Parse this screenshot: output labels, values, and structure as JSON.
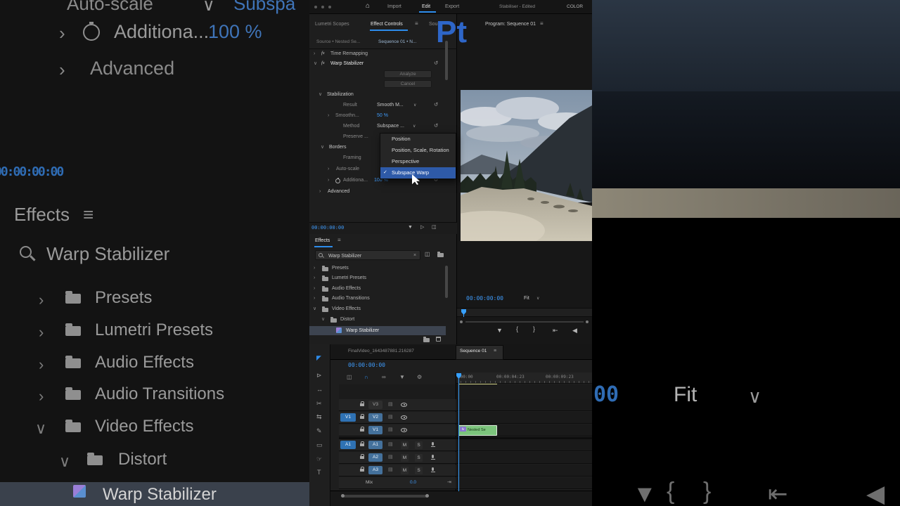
{
  "watermark": {
    "text": "Pt",
    "color": "#2e66c8"
  },
  "colors": {
    "accent": "#2d8ceb",
    "timecode": "#3f9bfa",
    "menu_highlight": "#2e5aa8",
    "clip_green": "#7cc47c",
    "target_badge": "#44719c"
  },
  "icons": {
    "hamburger": "≡",
    "home": "⌂",
    "chevron_right": "›",
    "chevron_down": "∨",
    "reset": "↺",
    "close": "×",
    "check": "✓",
    "fx": "fx",
    "funnel": "▼",
    "play_edit": "▷",
    "export": "◫",
    "mix_end": "⇥"
  },
  "app_bar": {
    "menu": [
      {
        "label": "Import",
        "active": false
      },
      {
        "label": "Edit",
        "active": true
      },
      {
        "label": "Export",
        "active": false
      }
    ],
    "project_status": "Stabiliser - Edited",
    "workspace": "COLOR"
  },
  "effect_controls": {
    "tabs": [
      {
        "label": "Lumetri Scopes",
        "active": false
      },
      {
        "label": "Effect Controls",
        "active": true
      },
      {
        "label": "Sourc",
        "active": false
      }
    ],
    "clip_tabs": {
      "source": "Source • Nested Se...",
      "sequence": "Sequence 01 • N..."
    },
    "effects": {
      "time_remapping": "Time Remapping",
      "warp_stabilizer": "Warp Stabilizer",
      "analyze_button": "Analyze",
      "cancel_button": "Cancel"
    },
    "stabilization": {
      "section": "Stabilization",
      "result_label": "Result",
      "result_value": "Smooth M...",
      "smoothness_label": "Smoothn...",
      "smoothness_value": "50 %",
      "method_label": "Method",
      "method_value": "Subspace ...",
      "preserve_label": "Preserve ...",
      "borders_section": "Borders",
      "framing_label": "Framing",
      "autoscale_label": "Auto-scale",
      "additional_label": "Additiona...",
      "additional_value": "100 %",
      "advanced_section": "Advanced"
    },
    "timecode": "00:00:00:00",
    "method_menu": [
      {
        "label": "Position",
        "checked": false
      },
      {
        "label": "Position, Scale, Rotation",
        "checked": false
      },
      {
        "label": "Perspective",
        "checked": false
      },
      {
        "label": "Subspace Warp",
        "checked": true
      }
    ]
  },
  "effects_panel": {
    "tab": "Effects",
    "search_value": "Warp Stabilizer",
    "tree": [
      {
        "label": "Presets",
        "type": "bin"
      },
      {
        "label": "Lumetri Presets",
        "type": "bin"
      },
      {
        "label": "Audio Effects",
        "type": "folder"
      },
      {
        "label": "Audio Transitions",
        "type": "folder"
      },
      {
        "label": "Video Effects",
        "type": "folder",
        "expanded": true
      },
      {
        "label": "Distort",
        "type": "folder",
        "expanded": true
      },
      {
        "label": "Warp Stabilizer",
        "type": "effect",
        "selected": true
      }
    ]
  },
  "program_monitor": {
    "tab": "Program: Sequence 01",
    "timecode": "00:00:00:00",
    "zoom_level": "Fit"
  },
  "timeline": {
    "background_tab": "FinalVideo_1643487881.216287",
    "active_tab": "Sequence 01",
    "timecode": "00:00:00:00",
    "ruler_labels": [
      ":00:00",
      "00:00:04:23",
      "00:00:09:23"
    ],
    "video_tracks": [
      {
        "name": "V3",
        "source": "",
        "targeted": false
      },
      {
        "name": "V2",
        "source": "V1",
        "targeted": true
      },
      {
        "name": "V1",
        "source": "",
        "targeted": true
      }
    ],
    "audio_tracks": [
      {
        "name": "A1",
        "source": "A1",
        "mute": "M",
        "solo": "S"
      },
      {
        "name": "A2",
        "source": "",
        "mute": "M",
        "solo": "S"
      },
      {
        "name": "A3",
        "source": "",
        "mute": "M",
        "solo": "S"
      }
    ],
    "mix": {
      "label": "Mix",
      "value": "0.0"
    },
    "clip": {
      "label": "Nested Se",
      "badge": "fx"
    }
  },
  "tools": [
    {
      "name": "selection-tool",
      "glyph": "◤",
      "active": true
    },
    {
      "name": "track-select-tool",
      "glyph": "⊳",
      "active": false
    },
    {
      "name": "ripple-edit-tool",
      "glyph": "↔",
      "active": false
    },
    {
      "name": "razor-tool",
      "glyph": "✂",
      "active": false
    },
    {
      "name": "slip-tool",
      "glyph": "⇆",
      "active": false
    },
    {
      "name": "pen-tool",
      "glyph": "✎",
      "active": false
    },
    {
      "name": "rectangle-tool",
      "glyph": "▭",
      "active": false
    },
    {
      "name": "hand-tool",
      "glyph": "☞",
      "active": false
    },
    {
      "name": "type-tool",
      "glyph": "T",
      "active": false
    }
  ],
  "transport": [
    {
      "name": "add-marker",
      "glyph": "▼"
    },
    {
      "name": "mark-in",
      "glyph": "{"
    },
    {
      "name": "mark-out",
      "glyph": "}"
    },
    {
      "name": "go-to-in",
      "glyph": "⇤"
    },
    {
      "name": "step-back",
      "glyph": "◀"
    }
  ],
  "timeline_toolbar": [
    {
      "name": "nest-toggle",
      "glyph": "◫",
      "active": false
    },
    {
      "name": "snap-toggle",
      "glyph": "∩",
      "active": true
    },
    {
      "name": "linked-selection",
      "glyph": "∞",
      "active": false
    },
    {
      "name": "add-marker",
      "glyph": "▼",
      "active": false
    },
    {
      "name": "timeline-settings",
      "glyph": "⚙",
      "active": false
    }
  ],
  "bg_left": {
    "autoscale_label": "Auto-scale",
    "subspace_fragment": "Subspa"
  },
  "bg_right": {
    "timecode_fragment": "00"
  }
}
